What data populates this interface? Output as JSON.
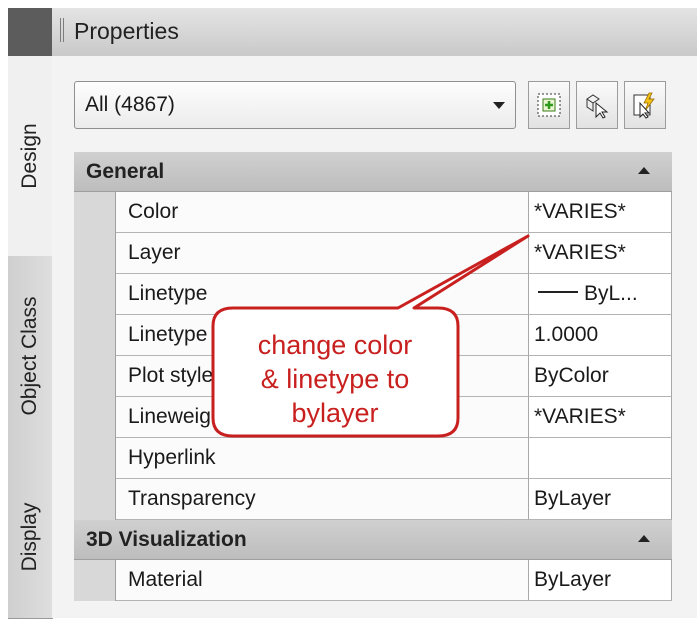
{
  "window": {
    "title": "Properties"
  },
  "side_tabs": [
    "Design",
    "Object Class",
    "Display"
  ],
  "selection": {
    "value": "All (4867)"
  },
  "toolbar": {
    "icons": [
      "quick-select-icon",
      "select-objects-icon",
      "toggle-pickadd-icon"
    ]
  },
  "sections": [
    {
      "label": "General",
      "rows": [
        {
          "name": "Color",
          "value": "*VARIES*"
        },
        {
          "name": "Layer",
          "value": "*VARIES*"
        },
        {
          "name": "Linetype",
          "value": "ByL..."
        },
        {
          "name": "Linetype scale",
          "value": "1.0000"
        },
        {
          "name": "Plot style",
          "value": "ByColor"
        },
        {
          "name": "Lineweight",
          "value": "*VARIES*"
        },
        {
          "name": "Hyperlink",
          "value": ""
        },
        {
          "name": "Transparency",
          "value": "ByLayer"
        }
      ]
    },
    {
      "label": "3D Visualization",
      "rows": [
        {
          "name": "Material",
          "value": "ByLayer"
        }
      ]
    }
  ],
  "callout": {
    "lines": [
      "change color",
      "& linetype to",
      "bylayer"
    ],
    "color": "#c8201f"
  }
}
